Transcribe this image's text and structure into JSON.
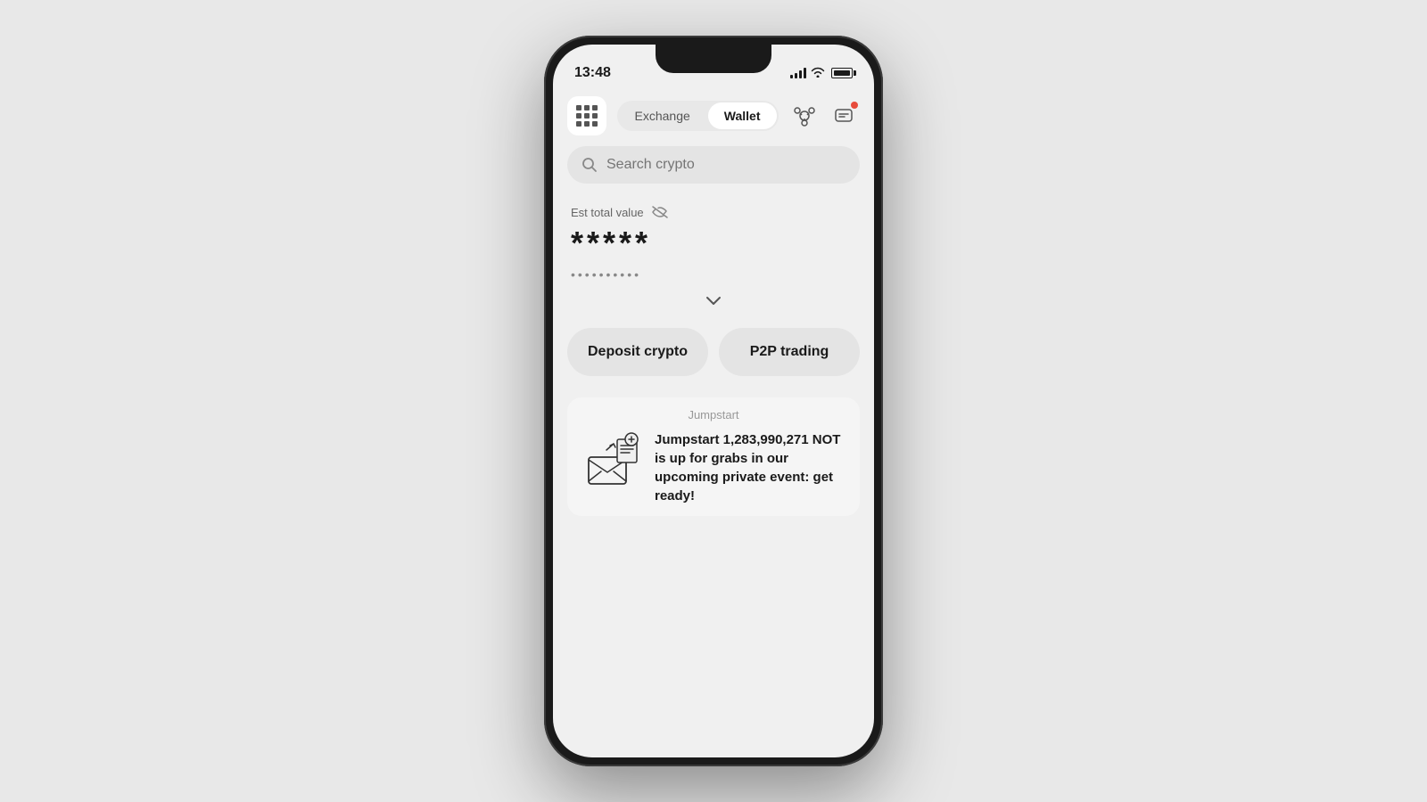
{
  "statusBar": {
    "time": "13:48"
  },
  "nav": {
    "gridIcon": "grid-icon",
    "tabs": [
      {
        "label": "Exchange",
        "active": false
      },
      {
        "label": "Wallet",
        "active": true
      }
    ],
    "actions": [
      "network-icon",
      "chat-icon"
    ]
  },
  "search": {
    "placeholder": "Search crypto"
  },
  "balance": {
    "estLabel": "Est total value",
    "hiddenIcon": "eye-off-icon",
    "mainBalance": "*****",
    "subBalance": "••••••••••",
    "chevron": "chevron-down-icon"
  },
  "actions": {
    "depositCrypto": "Deposit crypto",
    "p2pTrading": "P2P trading"
  },
  "jumpstart": {
    "label": "Jumpstart",
    "text": "Jumpstart 1,283,990,271 NOT is up for grabs in our upcoming private event: get ready!"
  }
}
